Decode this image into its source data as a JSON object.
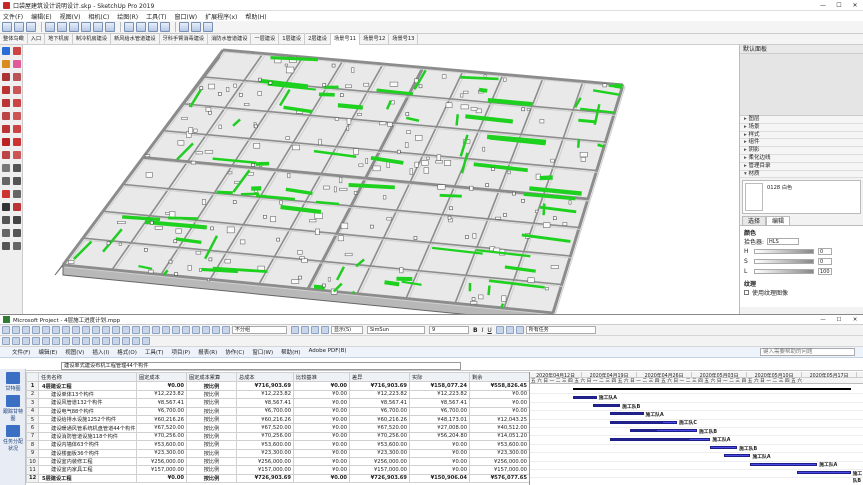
{
  "sketchup": {
    "title": "口袋屋建筑设计说明设计.skp - SketchUp Pro 2019",
    "menu": [
      "文件(F)",
      "编辑(E)",
      "视图(V)",
      "相机(C)",
      "绘图(R)",
      "工具(T)",
      "窗口(W)",
      "扩展程序(x)",
      "帮助(H)"
    ],
    "scene_tabs": [
      "整体鸟瞰",
      "入口",
      "地下机房",
      "制冷机房建设",
      "新风给水管道建设",
      "牙科手臂消毒建设",
      "消防水管道建设",
      "一层建设",
      "1层建设",
      "2层建设",
      "场景号11",
      "场景号12",
      "场景号13"
    ],
    "active_tab": 10,
    "tray": {
      "title": "默认面板",
      "sections": [
        "图层",
        "场景",
        "样式",
        "组件",
        "阴影",
        "柔化边线",
        "管理目录",
        "材质"
      ],
      "material_name": "0128 白色",
      "tabs": [
        "选择",
        "编辑"
      ],
      "color_label": "颜色",
      "picker_label": "拾色器:",
      "picker_value": "HLS",
      "sliders": [
        {
          "label": "H",
          "value": "0"
        },
        {
          "label": "S",
          "value": "0"
        },
        {
          "label": "L",
          "value": "100"
        }
      ],
      "texture_label": "纹理",
      "texture_option": "使用纹理图像"
    }
  },
  "project": {
    "title": "Microsoft Project - 4层施工进度计划.mpp",
    "font_name": "不分组",
    "view_name": "SimSun",
    "font_size": "9",
    "filter": "所有任务",
    "show_label": "显示(S)",
    "menu": [
      "文件(F)",
      "编辑(E)",
      "视图(V)",
      "插入(I)",
      "格式(O)",
      "工具(T)",
      "项目(P)",
      "报表(R)",
      "协作(C)",
      "窗口(W)",
      "帮助(H)",
      "Adobe PDF(B)"
    ],
    "search_placeholder": "键入需要帮助的问题",
    "entry_text": "建设单式建设布机工程管理44个构件",
    "sidebar": [
      {
        "label": "甘特图"
      },
      {
        "label": "跟踪甘特图"
      },
      {
        "label": "任务分配状况"
      }
    ],
    "columns": [
      "任务名称",
      "固定成本",
      "固定成本累算",
      "总成本",
      "比较基准",
      "差异",
      "实际",
      "剩余"
    ],
    "rows": [
      {
        "id": "1",
        "name": "4层建设工程",
        "fixed": "¥0.00",
        "accrue": "按比例",
        "total": "¥716,903.69",
        "baseline": "¥0.00",
        "variance": "¥716,903.69",
        "actual": "¥158,077.24",
        "remaining": "¥558,826.45",
        "summary": true
      },
      {
        "id": "2",
        "name": "建设单体13个构件",
        "fixed": "¥12,223.82",
        "accrue": "按比例",
        "total": "¥12,223.82",
        "baseline": "¥0.00",
        "variance": "¥12,223.82",
        "actual": "¥12,223.82",
        "remaining": "¥0.00",
        "summary": false
      },
      {
        "id": "3",
        "name": "建设风管道132个构件",
        "fixed": "¥8,567.41",
        "accrue": "按比例",
        "total": "¥8,567.41",
        "baseline": "¥0.00",
        "variance": "¥8,567.41",
        "actual": "¥8,567.41",
        "remaining": "¥0.00",
        "summary": false
      },
      {
        "id": "4",
        "name": "建设电气88个构件",
        "fixed": "¥6,700.00",
        "accrue": "按比例",
        "total": "¥6,700.00",
        "baseline": "¥0.00",
        "variance": "¥6,700.00",
        "actual": "¥6,700.00",
        "remaining": "¥0.00",
        "summary": false
      },
      {
        "id": "5",
        "name": "建设给排水设施1252个构件",
        "fixed": "¥60,216.26",
        "accrue": "按比例",
        "total": "¥60,216.26",
        "baseline": "¥0.00",
        "variance": "¥60,216.26",
        "actual": "¥48,173.01",
        "remaining": "¥12,043.25",
        "summary": false
      },
      {
        "id": "6",
        "name": "建设暖通风管系统机盘管道44个构件",
        "fixed": "¥67,520.00",
        "accrue": "按比例",
        "total": "¥67,520.00",
        "baseline": "¥0.00",
        "variance": "¥67,520.00",
        "actual": "¥27,008.00",
        "remaining": "¥40,512.00",
        "summary": false
      },
      {
        "id": "7",
        "name": "建设消防管道设施118个构件",
        "fixed": "¥70,256.00",
        "accrue": "按比例",
        "total": "¥70,256.00",
        "baseline": "¥0.00",
        "variance": "¥70,256.00",
        "actual": "¥56,204.80",
        "remaining": "¥14,051.20",
        "summary": false
      },
      {
        "id": "8",
        "name": "建设内墙体63个构件",
        "fixed": "¥53,600.00",
        "accrue": "按比例",
        "total": "¥53,600.00",
        "baseline": "¥0.00",
        "variance": "¥53,600.00",
        "actual": "¥0.00",
        "remaining": "¥53,600.00",
        "summary": false
      },
      {
        "id": "9",
        "name": "建设楼面板36个构件",
        "fixed": "¥23,300.00",
        "accrue": "按比例",
        "total": "¥23,300.00",
        "baseline": "¥0.00",
        "variance": "¥23,300.00",
        "actual": "¥0.00",
        "remaining": "¥23,300.00",
        "summary": false
      },
      {
        "id": "10",
        "name": "建设室内装修工程",
        "fixed": "¥256,000.00",
        "accrue": "按比例",
        "total": "¥256,000.00",
        "baseline": "¥0.00",
        "variance": "¥256,000.00",
        "actual": "¥0.00",
        "remaining": "¥256,000.00",
        "summary": false
      },
      {
        "id": "11",
        "name": "建设室内家具工程",
        "fixed": "¥157,000.00",
        "accrue": "按比例",
        "total": "¥157,000.00",
        "baseline": "¥0.00",
        "variance": "¥157,000.00",
        "actual": "¥0.00",
        "remaining": "¥157,000.00",
        "summary": false
      },
      {
        "id": "12",
        "name": "5层建设工程",
        "fixed": "¥0.00",
        "accrue": "按比例",
        "total": "¥726,903.69",
        "baseline": "¥0.00",
        "variance": "¥726,903.69",
        "actual": "¥150,906.04",
        "remaining": "¥576,077.65",
        "summary": true
      }
    ],
    "gantt": {
      "weeks": [
        "2020年04月12日",
        "2020年04月19日",
        "2020年04月26日",
        "2020年05月03日",
        "2020年05月10日",
        "2020年05月17日"
      ],
      "days": "五六日一二三四五六日一二三四五六日一二三四五六日一二三四五六日一二三四五六日一二三四五六",
      "bars": [
        {
          "row": 2,
          "start": 0.13,
          "end": 0.2,
          "progress": 1,
          "label": "施工队A"
        },
        {
          "row": 3,
          "start": 0.19,
          "end": 0.27,
          "progress": 1,
          "label": "施工队B"
        },
        {
          "row": 4,
          "start": 0.24,
          "end": 0.34,
          "progress": 1,
          "label": "施工队A"
        },
        {
          "row": 5,
          "start": 0.24,
          "end": 0.44,
          "progress": 0.8,
          "label": "施工队C"
        },
        {
          "row": 6,
          "start": 0.3,
          "end": 0.5,
          "progress": 0.4,
          "label": "施工队B"
        },
        {
          "row": 7,
          "start": 0.24,
          "end": 0.54,
          "progress": 0.8,
          "label": "施工队A"
        },
        {
          "row": 8,
          "start": 0.54,
          "end": 0.62,
          "progress": 0,
          "label": "施工队B"
        },
        {
          "row": 9,
          "start": 0.58,
          "end": 0.66,
          "progress": 0,
          "label": "施工队A"
        },
        {
          "row": 10,
          "start": 0.66,
          "end": 0.86,
          "progress": 0,
          "label": "施工队A"
        },
        {
          "row": 11,
          "start": 0.8,
          "end": 0.96,
          "progress": 0,
          "label": "施工队B"
        }
      ]
    }
  }
}
